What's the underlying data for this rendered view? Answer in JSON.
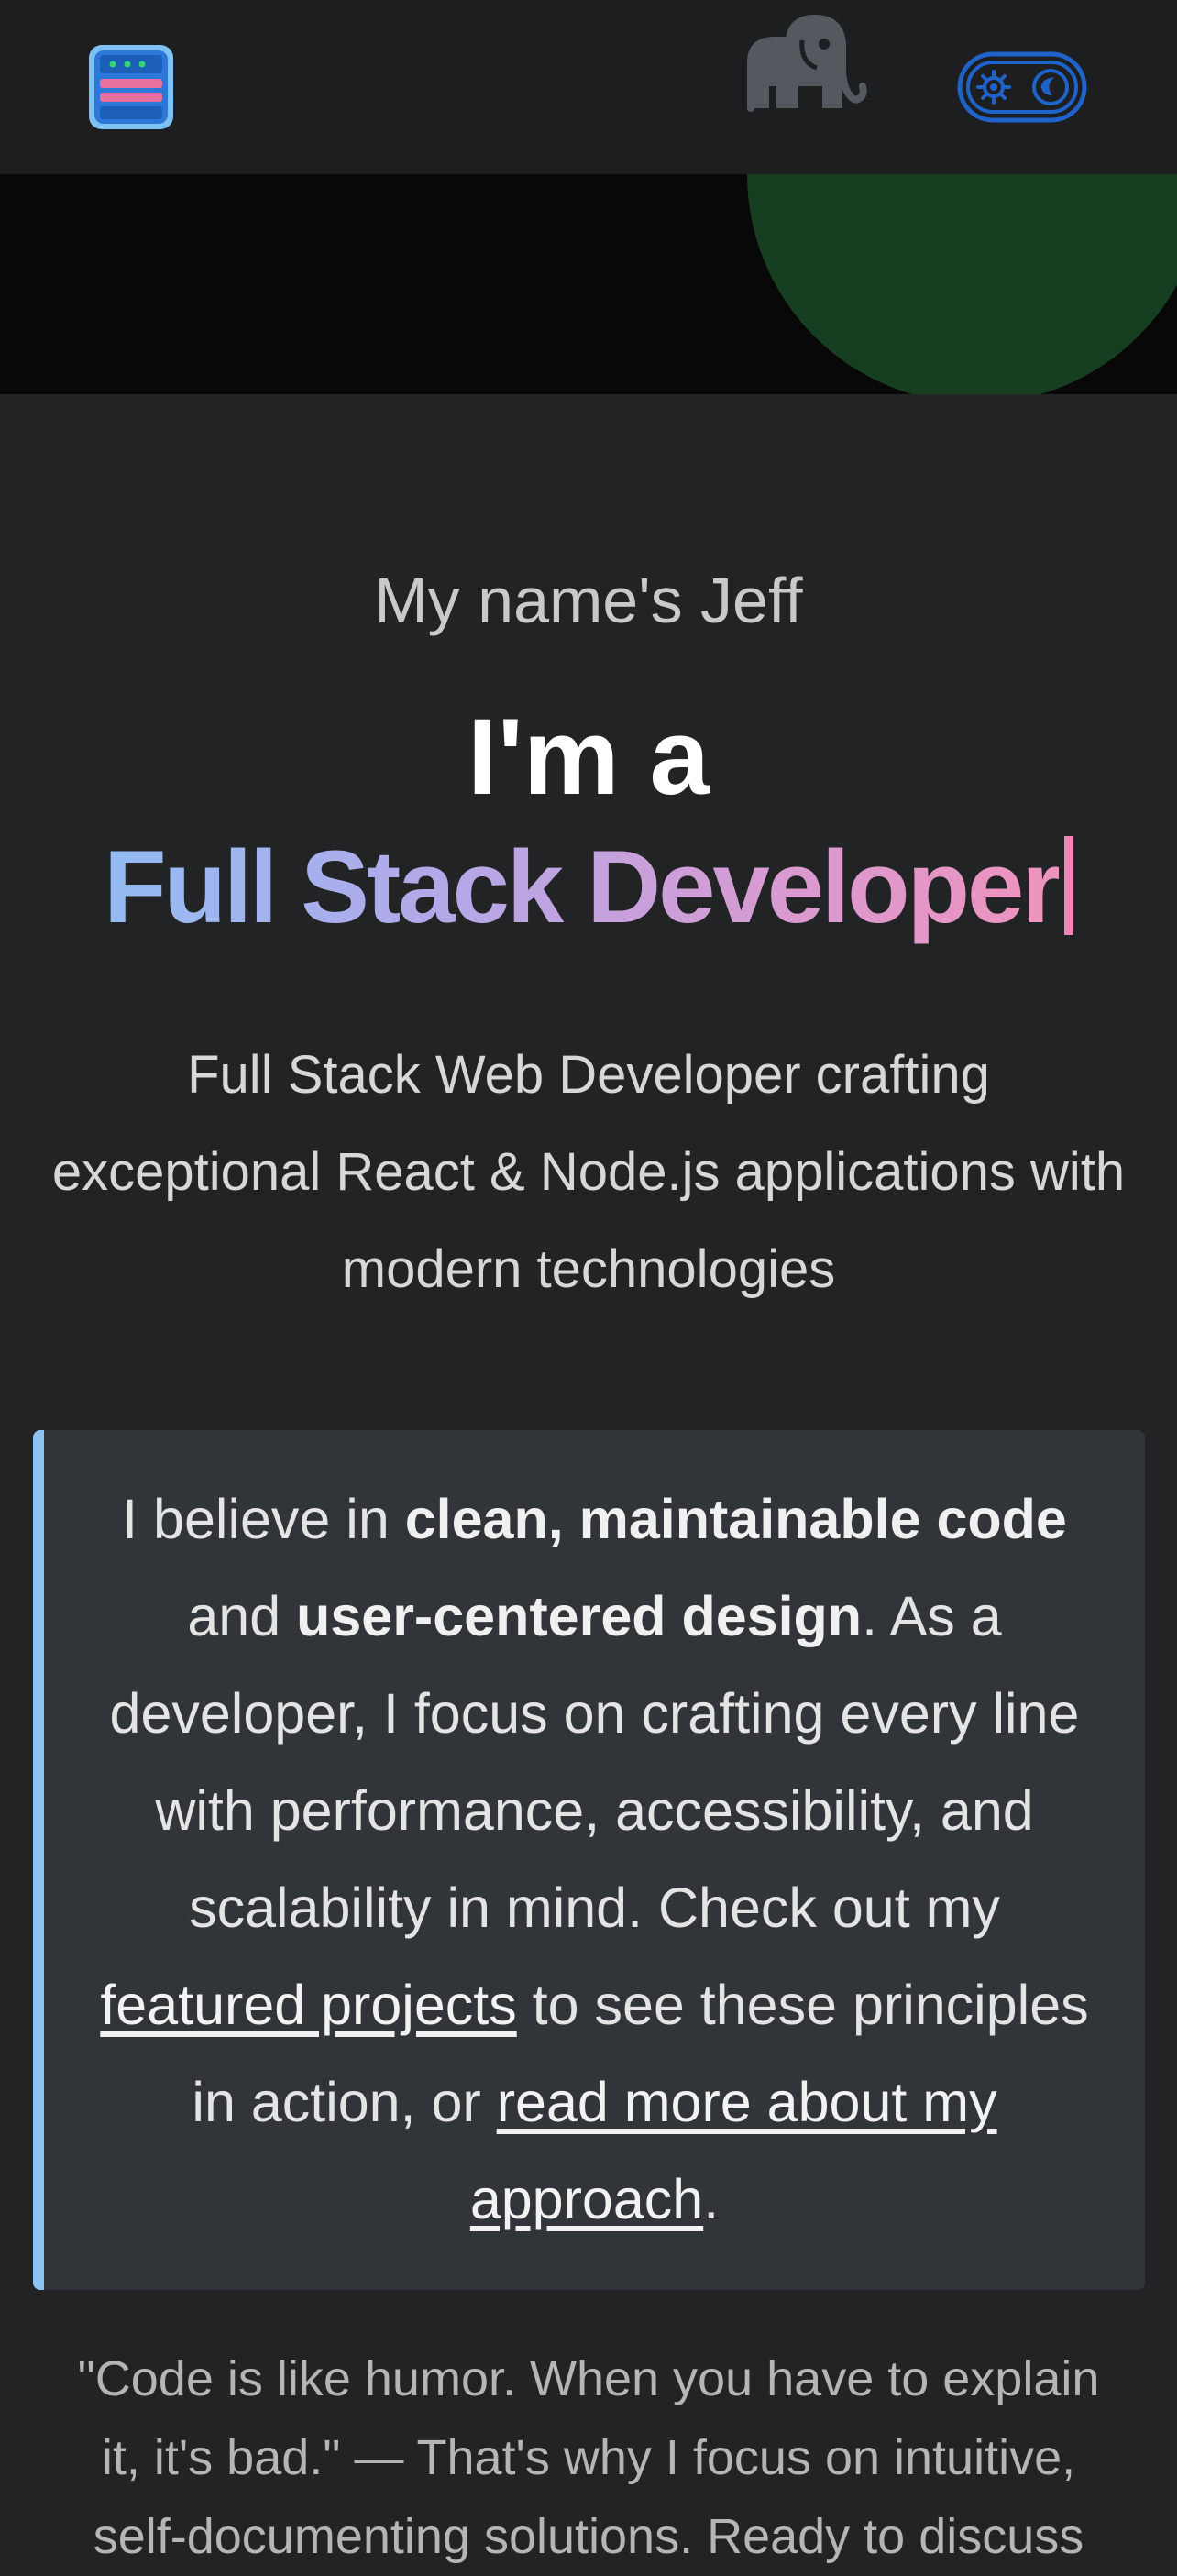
{
  "header": {
    "logo_icon": "server-stack-logo-icon",
    "mascot_icon": "elephant-icon",
    "theme_toggle_icons": [
      "gear-icon",
      "moon-icon"
    ],
    "colors": {
      "logo_blue": "#2b78d8",
      "logo_frame": "#7ec2f5",
      "logo_pink": "#e9709e",
      "logo_green": "#37d27a",
      "toggle_blue": "#1f62c9",
      "elephant": "#54595f",
      "band_blob": "#163f21"
    }
  },
  "hero": {
    "greeting": "My name's Jeff",
    "intro": "I'm a",
    "role": "Full Stack Developer",
    "subtitle": "Full Stack Web Developer crafting exceptional React & Node.js applications with modern technologies",
    "role_gradient": [
      "#93bdf2",
      "#b3a8e8",
      "#d79bd2",
      "#ef93bd"
    ]
  },
  "philosophy": {
    "t1": "I believe in ",
    "b1": "clean, maintainable code",
    "t2": " and ",
    "b2": "user-centered design",
    "t3": ". As a developer, I focus on crafting every line with performance, accessibility, and scalability in mind. Check out my ",
    "link1": "featured projects",
    "t4": " to see these principles in action, or ",
    "link2": "read more about my approach",
    "t5": ".",
    "accent_color": "#8ec3f5"
  },
  "quote": {
    "text": "\"Code is like humor. When you have to explain it, it's bad.\" — That's why I focus on intuitive, self-documenting solutions. Ready to discuss"
  }
}
